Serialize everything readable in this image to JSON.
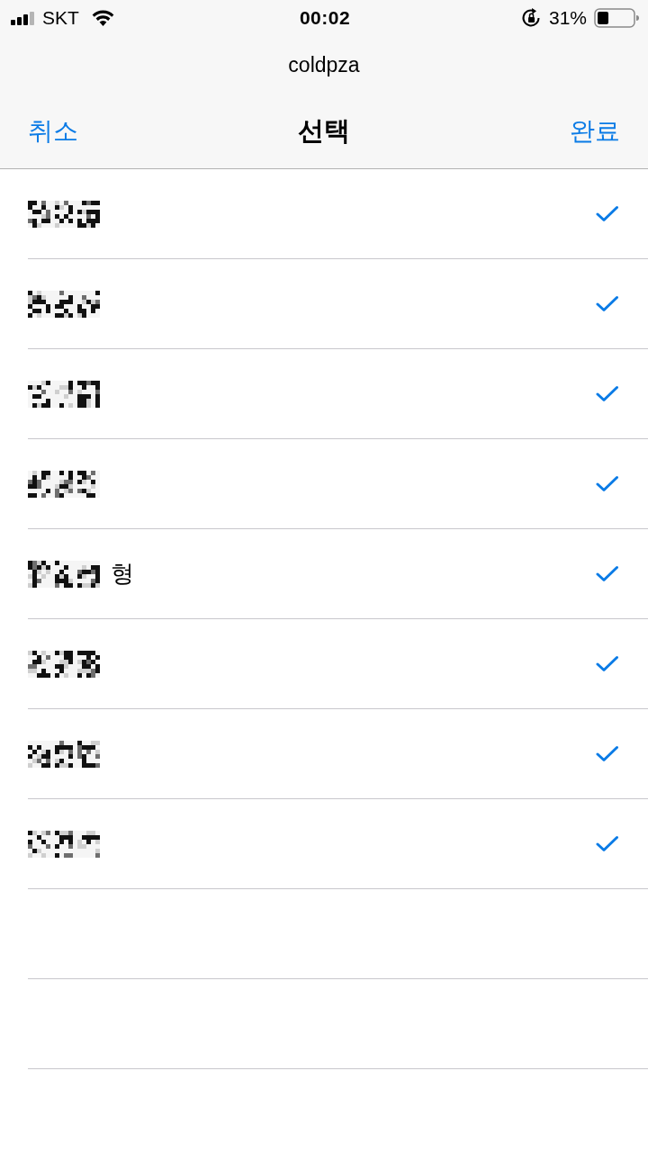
{
  "status_bar": {
    "carrier": "SKT",
    "time": "00:02",
    "battery": "31%"
  },
  "header": {
    "account": "coldpza",
    "cancel": "취소",
    "title": "선택",
    "done": "완료"
  },
  "contacts": [
    {
      "redacted": true,
      "checked": true
    },
    {
      "redacted": true,
      "checked": true
    },
    {
      "redacted": true,
      "checked": true
    },
    {
      "redacted": true,
      "checked": true
    },
    {
      "redacted": true,
      "suffix": "형",
      "checked": true
    },
    {
      "redacted": true,
      "checked": true
    },
    {
      "redacted": true,
      "checked": true
    },
    {
      "redacted": true,
      "checked": true
    }
  ]
}
